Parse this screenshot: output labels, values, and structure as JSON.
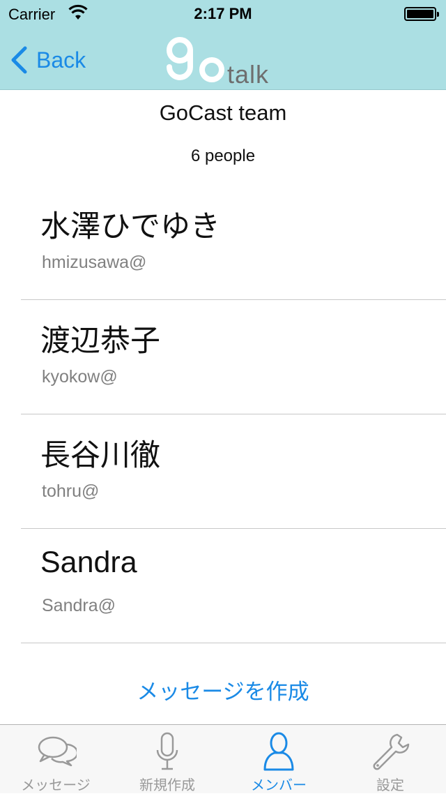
{
  "status_bar": {
    "carrier": "Carrier",
    "time": "2:17 PM"
  },
  "nav": {
    "back_label": "Back",
    "logo_text": "go",
    "logo_suffix": "talk"
  },
  "group": {
    "title": "GoCast team",
    "count": "6 people"
  },
  "members": [
    {
      "name": "水澤ひでゆき",
      "email": "hmizusawa@"
    },
    {
      "name": "渡辺恭子",
      "email": "kyokow@"
    },
    {
      "name": "長谷川徹",
      "email": "tohru@"
    },
    {
      "name": "Sandra",
      "email": "Sandra@"
    }
  ],
  "compose_label": "メッセージを作成",
  "tabs": [
    {
      "label": "メッセージ",
      "icon": "speech-bubbles-icon"
    },
    {
      "label": "新規作成",
      "icon": "microphone-icon"
    },
    {
      "label": "メンバー",
      "icon": "person-icon"
    },
    {
      "label": "設定",
      "icon": "wrench-icon"
    }
  ],
  "colors": {
    "nav_background": "#abdfe3",
    "accent": "#1a8ae6",
    "inactive_tab": "#999999"
  }
}
